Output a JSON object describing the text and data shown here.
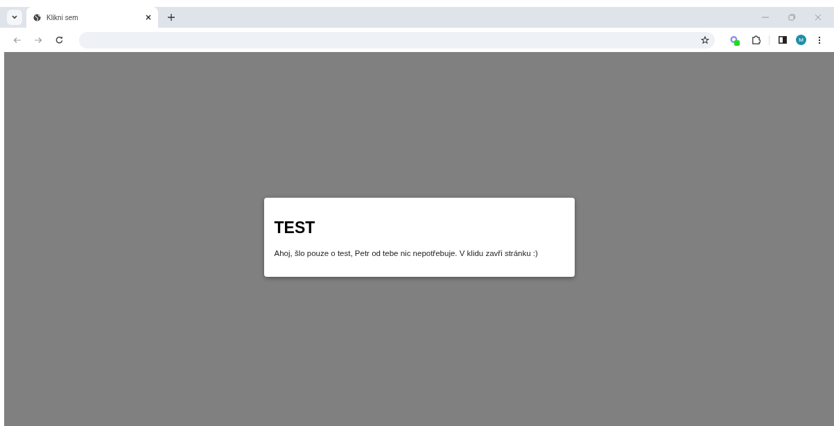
{
  "tabs": [
    {
      "title": "Klikni sem",
      "selected": true
    }
  ],
  "profile": {
    "initial": "M"
  },
  "dialog": {
    "title": "TEST",
    "message": "Ahoj, šlo pouze o test, Petr od tebe nic nepotřebuje. V klidu zavři stránku :)"
  }
}
